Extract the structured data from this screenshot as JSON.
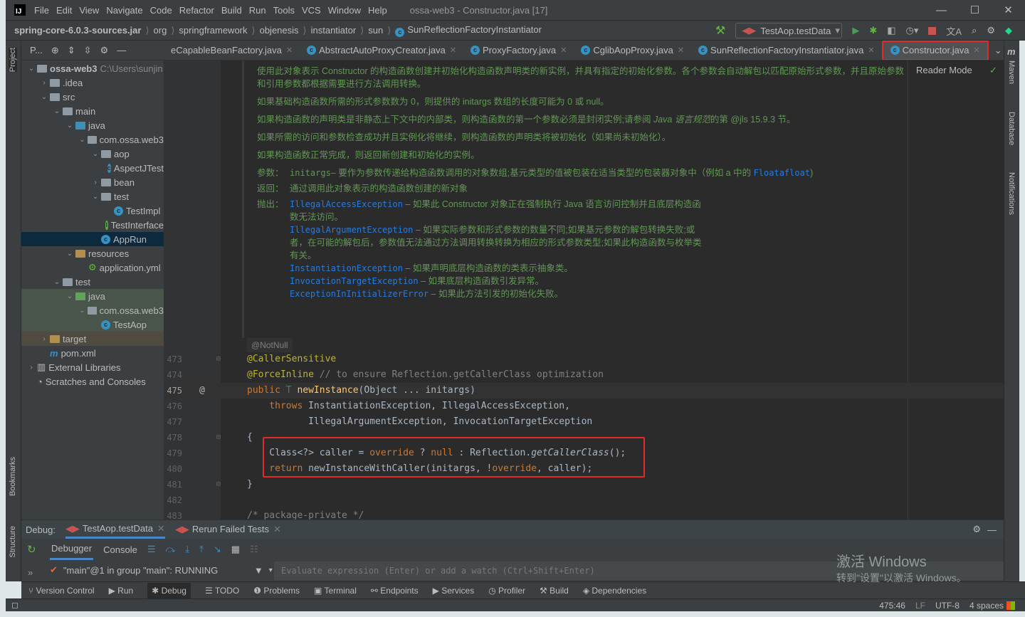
{
  "window": {
    "title": "ossa-web3 - Constructor.java [17]",
    "logo": "IJ",
    "menu": [
      "File",
      "Edit",
      "View",
      "Navigate",
      "Code",
      "Refactor",
      "Build",
      "Run",
      "Tools",
      "VCS",
      "Window",
      "Help"
    ]
  },
  "breadcrumb": [
    "spring-core-6.0.3-sources.jar",
    "org",
    "springframework",
    "objenesis",
    "instantiator",
    "sun",
    "SunReflectionFactoryInstantiator"
  ],
  "toolbar": {
    "run_config": "TestAop.testData"
  },
  "left_strip": {
    "project": "Project",
    "bookmarks": "Bookmarks",
    "structure": "Structure"
  },
  "right_strip": {
    "maven": "Maven",
    "database": "Database",
    "notifications": "Notifications"
  },
  "project": {
    "title": "P...",
    "tree": [
      {
        "label": "ossa-web3",
        "hint": "C:\\Users\\sunjin",
        "depth": 0,
        "arrow": "v",
        "icon": "module",
        "bold": true
      },
      {
        "label": ".idea",
        "depth": 1,
        "arrow": ">",
        "icon": "folder"
      },
      {
        "label": "src",
        "depth": 1,
        "arrow": "v",
        "icon": "folder"
      },
      {
        "label": "main",
        "depth": 2,
        "arrow": "v",
        "icon": "folder"
      },
      {
        "label": "java",
        "depth": 3,
        "arrow": "v",
        "icon": "folder-blue"
      },
      {
        "label": "com.ossa.web3",
        "depth": 4,
        "arrow": "v",
        "icon": "package"
      },
      {
        "label": "aop",
        "depth": 5,
        "arrow": "v",
        "icon": "package"
      },
      {
        "label": "AspectJTest",
        "depth": 6,
        "arrow": "",
        "icon": "class"
      },
      {
        "label": "bean",
        "depth": 5,
        "arrow": ">",
        "icon": "package"
      },
      {
        "label": "test",
        "depth": 5,
        "arrow": "v",
        "icon": "package"
      },
      {
        "label": "TestImpl",
        "depth": 6,
        "arrow": "",
        "icon": "class"
      },
      {
        "label": "TestInterface",
        "depth": 6,
        "arrow": "",
        "icon": "interface"
      },
      {
        "label": "AppRun",
        "depth": 5,
        "arrow": "",
        "icon": "class",
        "selected": true
      },
      {
        "label": "resources",
        "depth": 3,
        "arrow": "v",
        "icon": "folder-orange"
      },
      {
        "label": "application.yml",
        "depth": 4,
        "arrow": "",
        "icon": "yml"
      },
      {
        "label": "test",
        "depth": 2,
        "arrow": "v",
        "icon": "folder"
      },
      {
        "label": "java",
        "depth": 3,
        "arrow": "v",
        "icon": "folder-green",
        "test": true
      },
      {
        "label": "com.ossa.web3",
        "depth": 4,
        "arrow": "v",
        "icon": "package",
        "test": true
      },
      {
        "label": "TestAop",
        "depth": 5,
        "arrow": "",
        "icon": "class",
        "test": true
      },
      {
        "label": "target",
        "depth": 1,
        "arrow": ">",
        "icon": "folder-orange",
        "target": true
      },
      {
        "label": "pom.xml",
        "depth": 1,
        "arrow": "",
        "icon": "maven"
      },
      {
        "label": "External Libraries",
        "depth": 0,
        "arrow": ">",
        "icon": "libs"
      },
      {
        "label": "Scratches and Consoles",
        "depth": 0,
        "arrow": "",
        "icon": "scratch"
      }
    ]
  },
  "tabs": [
    {
      "label": "eCapableBeanFactory.java"
    },
    {
      "label": "AbstractAutoProxyCreator.java"
    },
    {
      "label": "ProxyFactory.java"
    },
    {
      "label": "CglibAopProxy.java"
    },
    {
      "label": "SunReflectionFactoryInstantiator.java"
    },
    {
      "label": "Constructor.java",
      "active": true
    }
  ],
  "editor": {
    "reader_mode": "Reader Mode",
    "doc": {
      "p1": "使用此对象表示 Constructor 的构造函数创建并初始化构造函数声明类的新实例，并具有指定的初始化参数。各个参数会自动解包以匹配原始形式参数，并且原始参数和引用参数都根据需要进行方法调用转换。",
      "p2": "如果基础构造函数所需的形式参数数为 0，则提供的 initargs 数组的长度可能为 0 或 null。",
      "p3a": "如果构造函数的声明类是非静态上下文中的内部类，则构造函数的第一个参数必须是封闭实例;请参阅 ",
      "p3b": "Java 语言规范",
      "p3c": "的第 @jls 15.9.3 节。",
      "p4": "如果所需的访问和参数检查成功并且实例化将继续，则构造函数的声明类将被初始化（如果尚未初始化）。",
      "p5": "如果构造函数正常完成，则返回新创建和初始化的实例。",
      "params_label": "参数：",
      "params_name": "initargs",
      "params_text": "– 要作为参数传递给构造函数调用的对象数组;基元类型的值被包装在适当类型的包装器对象中（例如 a 中的 ",
      "params_link": "Floatafloat",
      "params_end": ")",
      "returns_label": "返回：",
      "returns_text": "通过调用此对象表示的构造函数创建的新对象",
      "throws_label": "抛出：",
      "throws": [
        {
          "ex": "IllegalAccessException",
          "text": " – 如果此 Constructor 对象正在强制执行 Java 语言访问控制并且底层构造函数无法访问。"
        },
        {
          "ex": "IllegalArgumentException",
          "text": " – 如果实际参数和形式参数的数量不同;如果基元参数的解包转换失败;或者，在可能的解包后，参数值无法通过方法调用转换转换为相应的形式参数类型;如果此构造函数与枚举类有关。"
        },
        {
          "ex": "InstantiationException",
          "text": " – 如果声明底层构造函数的类表示抽象类。"
        },
        {
          "ex": "InvocationTargetException",
          "text": " – 如果底层构造函数引发异常。"
        },
        {
          "ex": "ExceptionInInitializerError",
          "text": " – 如果此方法引发的初始化失败。"
        }
      ]
    },
    "inlay": "@NotNull",
    "lines": [
      {
        "n": "473",
        "tokens": [
          [
            "ann",
            "@CallerSensitive"
          ]
        ]
      },
      {
        "n": "474",
        "tokens": [
          [
            "ann",
            "@ForceInline"
          ],
          [
            "cm",
            " // to ensure Reflection.getCallerClass optimization"
          ]
        ]
      },
      {
        "n": "475",
        "current": true,
        "tokens": [
          [
            "kw",
            "public "
          ],
          [
            "ty",
            "T "
          ],
          [
            "fn",
            "newInstance"
          ],
          [
            "txt",
            "(Object ... initargs)"
          ]
        ]
      },
      {
        "n": "476",
        "tokens": [
          [
            "kw",
            "    throws "
          ],
          [
            "txt",
            "InstantiationException, IllegalAccessException,"
          ]
        ]
      },
      {
        "n": "477",
        "tokens": [
          [
            "txt",
            "           IllegalArgumentException, InvocationTargetException"
          ]
        ]
      },
      {
        "n": "478",
        "tokens": [
          [
            "txt",
            "{"
          ]
        ]
      },
      {
        "n": "479",
        "tokens": [
          [
            "txt",
            "    Class<?> caller = "
          ],
          [
            "kw",
            "override "
          ],
          [
            "txt",
            "? "
          ],
          [
            "kw",
            "null "
          ],
          [
            "txt",
            ": Reflection."
          ],
          [
            "it",
            "getCallerClass"
          ],
          [
            "txt",
            "();"
          ]
        ]
      },
      {
        "n": "480",
        "tokens": [
          [
            "kw",
            "    return "
          ],
          [
            "txt",
            "newInstanceWithCaller(initargs, !"
          ],
          [
            "kw",
            "override"
          ],
          [
            "txt",
            ", caller);"
          ]
        ]
      },
      {
        "n": "481",
        "tokens": [
          [
            "txt",
            "}"
          ]
        ]
      },
      {
        "n": "482",
        "tokens": []
      },
      {
        "n": "483",
        "tokens": [
          [
            "cm",
            "/* package-private */"
          ]
        ]
      }
    ]
  },
  "debug": {
    "label": "Debug:",
    "tabs": [
      "TestAop.testData",
      "Rerun Failed Tests"
    ],
    "subtabs": [
      "Debugger",
      "Console"
    ],
    "thread": "\"main\"@1 in group \"main\": RUNNING",
    "eval_placeholder": "Evaluate expression (Enter) or add a watch (Ctrl+Shift+Enter)"
  },
  "tool_windows": [
    "Version Control",
    "Run",
    "Debug",
    "TODO",
    "Problems",
    "Terminal",
    "Endpoints",
    "Services",
    "Profiler",
    "Build",
    "Dependencies"
  ],
  "status": {
    "position": "475:46",
    "line_sep": "LF",
    "encoding": "UTF-8",
    "indent": "4 spaces"
  },
  "watermark": {
    "line1": "激活 Windows",
    "line2": "转到\"设置\"以激活 Windows。"
  },
  "colors": {
    "highlight_box": "#e32a2a",
    "doc_text": "#629755",
    "link": "#287bde",
    "keyword": "#cc7832",
    "annotation": "#bbb529"
  }
}
